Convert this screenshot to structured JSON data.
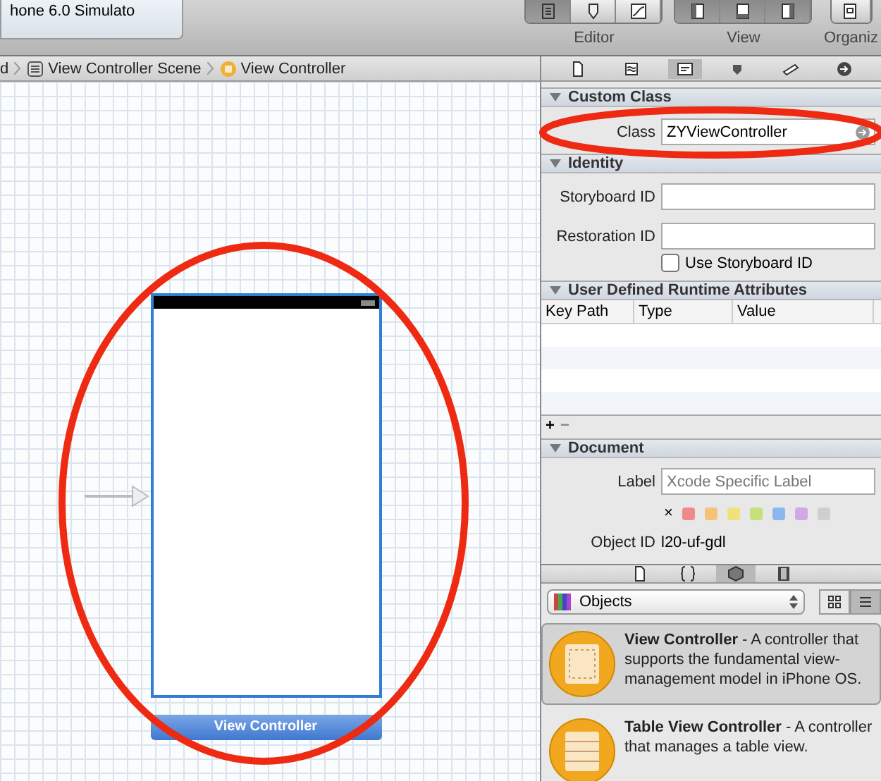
{
  "toolbar": {
    "scheme_text": "hone 6.0 Simulato",
    "groups": [
      {
        "label": "Editor",
        "buttons": [
          {
            "selected": true
          },
          {
            "selected": false
          },
          {
            "selected": false
          }
        ]
      },
      {
        "label": "View",
        "buttons": [
          {
            "selected": true
          },
          {
            "selected": true
          },
          {
            "selected": true
          }
        ]
      },
      {
        "label": "Organiz",
        "buttons": [
          {
            "selected": false
          }
        ]
      }
    ]
  },
  "breadcrumb": [
    {
      "kind": "cut",
      "label": "d"
    },
    {
      "kind": "scene",
      "label": "View Controller Scene"
    },
    {
      "kind": "controller",
      "label": "View Controller"
    }
  ],
  "inspector_tabs": [
    {
      "selected": false
    },
    {
      "selected": false
    },
    {
      "selected": true
    },
    {
      "selected": false
    },
    {
      "selected": false
    },
    {
      "selected": false
    }
  ],
  "custom_class": {
    "title": "Custom Class",
    "expanded": true,
    "class_label": "Class",
    "class_value": "ZYViewController"
  },
  "identity": {
    "title": "Identity",
    "expanded": true,
    "storyboard_id_label": "Storyboard ID",
    "restoration_id_label": "Restoration ID",
    "use_storyboard_id": {
      "label": "Use Storyboard ID",
      "checked": false
    }
  },
  "runtime_attributes": {
    "title": "User Defined Runtime Attributes",
    "expanded": true,
    "columns": [
      "Key Path",
      "Type",
      "Value"
    ],
    "add": "+",
    "remove": "−"
  },
  "document": {
    "title": "Document",
    "expanded": true,
    "label_label": "Label",
    "label_placeholder": "Xcode Specific Label",
    "clear": "×",
    "swatches": [
      {
        "color": "#f08a8a"
      },
      {
        "color": "#f6c27a"
      },
      {
        "color": "#f0e27a"
      },
      {
        "color": "#c6e07a"
      },
      {
        "color": "#8ab8ee"
      },
      {
        "color": "#d2a8e6"
      },
      {
        "color": "#cfcfcf"
      }
    ],
    "object_id_label": "Object ID",
    "object_id": "l20-uf-gdl"
  },
  "library_tabs": [
    {
      "selected": false
    },
    {
      "selected": false
    },
    {
      "selected": true
    },
    {
      "selected": false
    }
  ],
  "library": {
    "popup": "Objects",
    "view_modes": [
      {
        "selected": false
      },
      {
        "selected": true
      }
    ],
    "items": [
      {
        "kind": "view",
        "title": "View Controller",
        "description": " - A controller that supports the fundamental view-management model in iPhone OS.",
        "selected": true
      },
      {
        "kind": "table",
        "title": "Table View Controller",
        "description": " - A controller that manages a table view.",
        "selected": false
      }
    ]
  },
  "canvas": {
    "scene_label": "View Controller",
    "initial": true,
    "selected": true
  },
  "annotations": [
    {
      "kind": "ellipse"
    },
    {
      "kind": "ellipse"
    }
  ]
}
